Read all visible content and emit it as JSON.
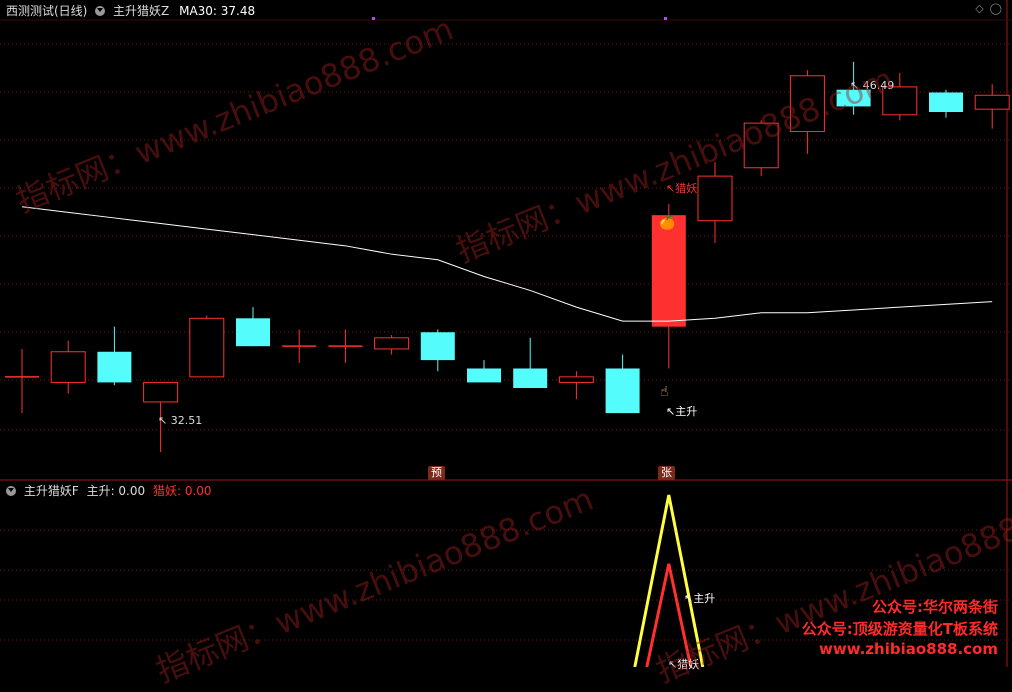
{
  "upper": {
    "title": "西测测试(日线)",
    "indicator": "主升猎妖Z",
    "ma_label": "MA30: 37.48"
  },
  "lower": {
    "indicator": "主升猎妖F",
    "zhusheng_label": "主升: 0.00",
    "lieyao_label": "猎妖: 0.00"
  },
  "annotations": {
    "high_price": "46.49",
    "low_price": "32.51",
    "lieyao": "猎妖",
    "zhusheng": "主升",
    "sig_yu": "预",
    "sig_zhang": "张",
    "lower_zhusheng": "主升",
    "lower_lieyao": "猎妖"
  },
  "watermark": "指标网：www.zhibiao888.com",
  "promo": {
    "line1": "公众号:华尔两条街",
    "line2": "公众号:顶级游资量化T板系统",
    "line3": "www.zhibiao888.com"
  },
  "colors": {
    "up": "#ff3030",
    "down": "#54fcfc",
    "ma": "#ffffff",
    "grid": "#7a1010",
    "signal_line": "#ffff40"
  },
  "chart_data": {
    "type": "candlestick",
    "ma_label": "MA30",
    "candles": [
      {
        "o": 35.2,
        "h": 36.2,
        "l": 33.9,
        "c": 35.2
      },
      {
        "o": 35.0,
        "h": 36.5,
        "l": 34.6,
        "c": 36.1
      },
      {
        "o": 36.1,
        "h": 37.0,
        "l": 34.9,
        "c": 35.0
      },
      {
        "o": 34.3,
        "h": 35.0,
        "l": 32.5,
        "c": 35.0
      },
      {
        "o": 35.2,
        "h": 37.4,
        "l": 35.2,
        "c": 37.3
      },
      {
        "o": 37.3,
        "h": 37.7,
        "l": 36.3,
        "c": 36.3
      },
      {
        "o": 36.3,
        "h": 36.9,
        "l": 35.7,
        "c": 36.3
      },
      {
        "o": 36.3,
        "h": 36.9,
        "l": 35.7,
        "c": 36.3
      },
      {
        "o": 36.2,
        "h": 36.7,
        "l": 36.0,
        "c": 36.6
      },
      {
        "o": 36.8,
        "h": 36.9,
        "l": 35.4,
        "c": 35.8
      },
      {
        "o": 35.5,
        "h": 35.8,
        "l": 35.0,
        "c": 35.0
      },
      {
        "o": 35.5,
        "h": 36.6,
        "l": 34.8,
        "c": 34.8
      },
      {
        "o": 35.0,
        "h": 35.4,
        "l": 34.4,
        "c": 35.2
      },
      {
        "o": 35.5,
        "h": 36.0,
        "l": 33.9,
        "c": 33.9
      },
      {
        "o": 37.0,
        "h": 41.4,
        "l": 35.5,
        "c": 41.0
      },
      {
        "o": 40.8,
        "h": 42.9,
        "l": 40.0,
        "c": 42.4
      },
      {
        "o": 42.7,
        "h": 44.4,
        "l": 42.4,
        "c": 44.3
      },
      {
        "o": 44.0,
        "h": 46.2,
        "l": 43.2,
        "c": 46.0
      },
      {
        "o": 45.5,
        "h": 46.5,
        "l": 44.6,
        "c": 44.9
      },
      {
        "o": 44.6,
        "h": 46.1,
        "l": 44.4,
        "c": 45.6
      },
      {
        "o": 45.4,
        "h": 45.5,
        "l": 44.5,
        "c": 44.7
      },
      {
        "o": 44.8,
        "h": 45.7,
        "l": 44.1,
        "c": 45.3
      }
    ],
    "ma30": [
      41.3,
      41.1,
      40.9,
      40.7,
      40.5,
      40.3,
      40.1,
      39.9,
      39.6,
      39.4,
      38.8,
      38.3,
      37.7,
      37.2,
      37.2,
      37.3,
      37.5,
      37.5,
      37.6,
      37.7,
      37.8,
      37.9
    ],
    "signal_zhusheng": [
      0,
      0,
      0,
      0,
      0,
      0,
      0,
      0,
      0,
      0,
      0,
      0,
      0,
      0,
      1,
      0,
      0,
      0,
      0,
      0,
      0,
      0
    ],
    "signal_lieyao": [
      0,
      0,
      0,
      0,
      0,
      0,
      0,
      0,
      0,
      0,
      0,
      0,
      0,
      0,
      0.6,
      0,
      0,
      0,
      0,
      0,
      0,
      0
    ]
  }
}
